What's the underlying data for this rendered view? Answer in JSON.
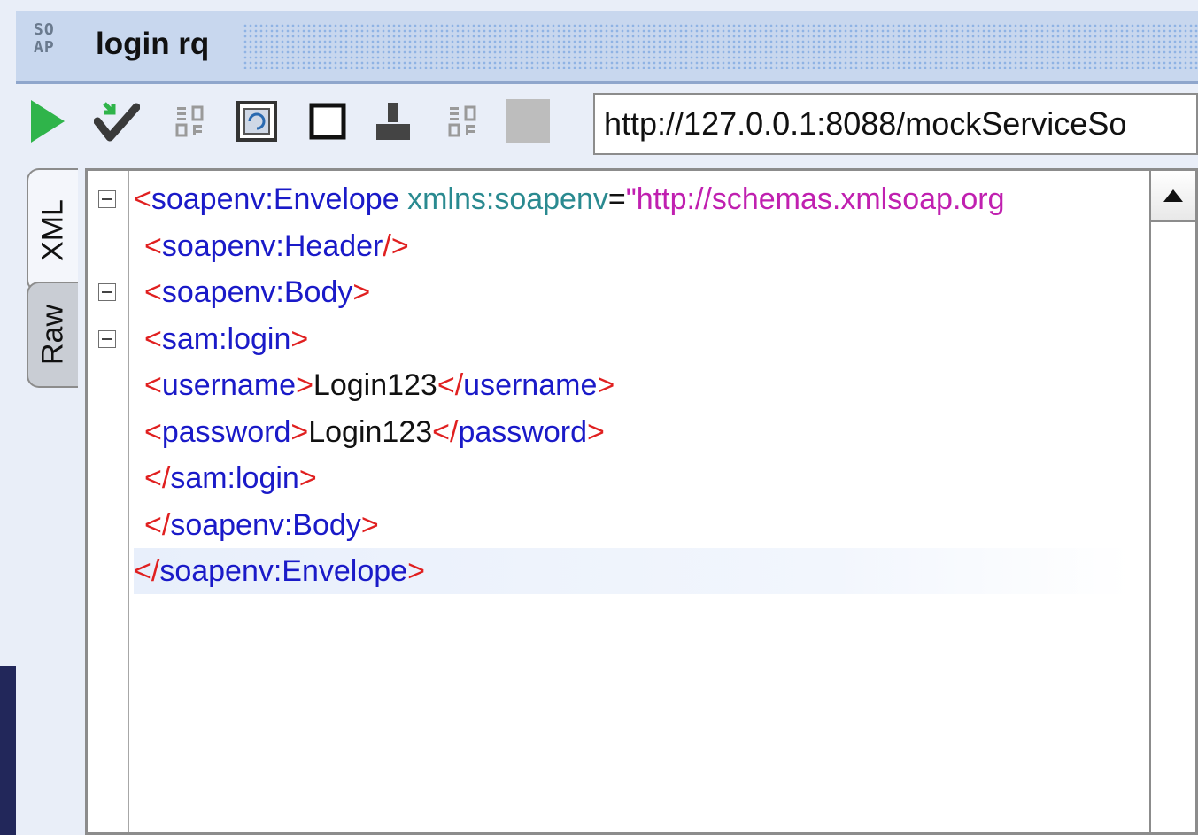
{
  "window": {
    "logo_text_top": "SO",
    "logo_text_bottom": "AP",
    "title": "login rq"
  },
  "toolbar": {
    "icons": [
      "run-icon",
      "validate-icon",
      "soap-icon",
      "refresh-icon",
      "checkbox-icon",
      "stamp-icon",
      "soap-icon",
      "stop-icon"
    ],
    "endpoint_url": "http://127.0.0.1:8088/mockServiceSo"
  },
  "side_tabs": {
    "xml": "XML",
    "raw": "Raw"
  },
  "editor": {
    "lines": [
      {
        "indent": 0,
        "b1": "<",
        "tag": "soapenv:Envelope",
        "attr": " xmlns:soapenv",
        "eq": "=",
        "val": "\"http://schemas.xmlsoap.org",
        "b2": "",
        "text": "",
        "b3": "",
        "ctag": "",
        "b4": ""
      },
      {
        "indent": 1,
        "b1": "<",
        "tag": "soapenv:Header",
        "attr": "",
        "eq": "",
        "val": "",
        "b2": "/>",
        "text": "",
        "b3": "",
        "ctag": "",
        "b4": ""
      },
      {
        "indent": 1,
        "b1": "<",
        "tag": "soapenv:Body",
        "attr": "",
        "eq": "",
        "val": "",
        "b2": ">",
        "text": "",
        "b3": "",
        "ctag": "",
        "b4": ""
      },
      {
        "indent": 1,
        "b1": "<",
        "tag": "sam:login",
        "attr": "",
        "eq": "",
        "val": "",
        "b2": ">",
        "text": "",
        "b3": "",
        "ctag": "",
        "b4": ""
      },
      {
        "indent": 1,
        "b1": "<",
        "tag": "username",
        "attr": "",
        "eq": "",
        "val": "",
        "b2": ">",
        "text": "Login123",
        "b3": "</",
        "ctag": "username",
        "b4": ">"
      },
      {
        "indent": 1,
        "b1": "<",
        "tag": "password",
        "attr": "",
        "eq": "",
        "val": "",
        "b2": ">",
        "text": "Login123",
        "b3": "</",
        "ctag": "password",
        "b4": ">"
      },
      {
        "indent": 1,
        "b1": "</",
        "tag": "sam:login",
        "attr": "",
        "eq": "",
        "val": "",
        "b2": ">",
        "text": "",
        "b3": "",
        "ctag": "",
        "b4": ""
      },
      {
        "indent": 1,
        "b1": "</",
        "tag": "soapenv:Body",
        "attr": "",
        "eq": "",
        "val": "",
        "b2": ">",
        "text": "",
        "b3": "",
        "ctag": "",
        "b4": ""
      },
      {
        "indent": 0,
        "b1": "</",
        "tag": "soapenv:Envelope",
        "attr": "",
        "eq": "",
        "val": "",
        "b2": ">",
        "text": "",
        "b3": "",
        "ctag": "",
        "b4": ""
      }
    ],
    "folded_line_indices": [
      0,
      2,
      3
    ],
    "highlighted_line_index": 8
  },
  "colors": {
    "bracket": "#e02020",
    "tag": "#1a1ac8",
    "attribute": "#2a8a90",
    "value": "#c020b0",
    "run_green": "#2fb44a"
  }
}
